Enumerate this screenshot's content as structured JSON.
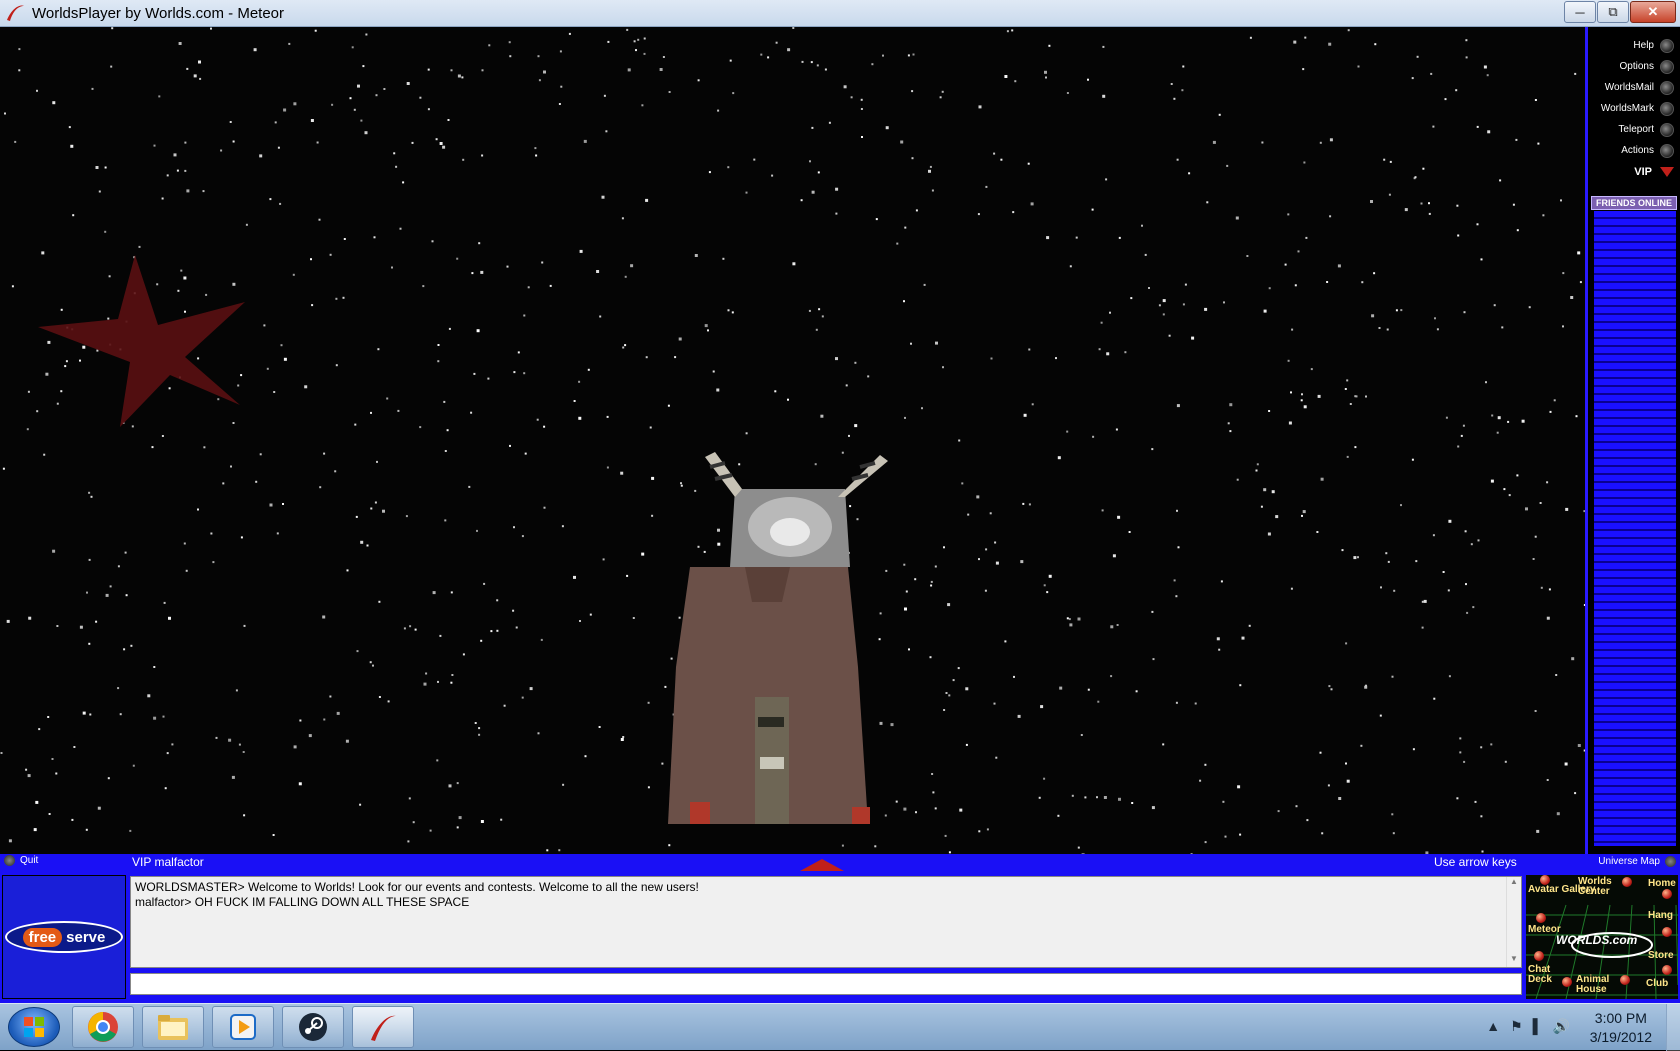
{
  "window": {
    "title": "WorldsPlayer by Worlds.com - Meteor",
    "icon": "worlds-swoosh-icon",
    "buttons": [
      "minimize",
      "restore",
      "close"
    ]
  },
  "nav": {
    "items": [
      {
        "label": "Help"
      },
      {
        "label": "Options"
      },
      {
        "label": "WorldsMail"
      },
      {
        "label": "WorldsMark"
      },
      {
        "label": "Teleport"
      },
      {
        "label": "Actions"
      }
    ],
    "vip_label": "VIP",
    "friends_online_label": "FRIENDS ONLINE"
  },
  "status": {
    "quit_label": "Quit",
    "user_label": "VIP malfactor",
    "hint": "Use arrow keys",
    "universe_map_label": "Universe Map"
  },
  "ad": {
    "free": "free",
    "serve": "serve"
  },
  "chat": {
    "lines": [
      "WORLDSMASTER> Welcome to Worlds! Look for our events and contests. Welcome to all the new users!",
      "malfactor> OH FUCK IM FALLING DOWN ALL THESE SPACE"
    ],
    "input_value": ""
  },
  "map": {
    "avatar_gallery": "Avatar Gallery",
    "worlds_center": "Worlds Center",
    "home": "Home",
    "meteor": "Meteor",
    "hang": "Hang",
    "store": "Store",
    "chat_deck": "Chat Deck",
    "animal_house": "Animal House",
    "club": "Club",
    "logo": "WORLDS.com"
  },
  "taskbar": {
    "apps": [
      "chrome-icon",
      "explorer-folder-icon",
      "media-player-icon",
      "steam-icon",
      "worldsplayer-icon"
    ],
    "time": "3:00 PM",
    "date": "3/19/2012"
  },
  "colors": {
    "panel_blue": "#1a10f5",
    "accent_red": "#c0201a",
    "space": "#050505"
  }
}
